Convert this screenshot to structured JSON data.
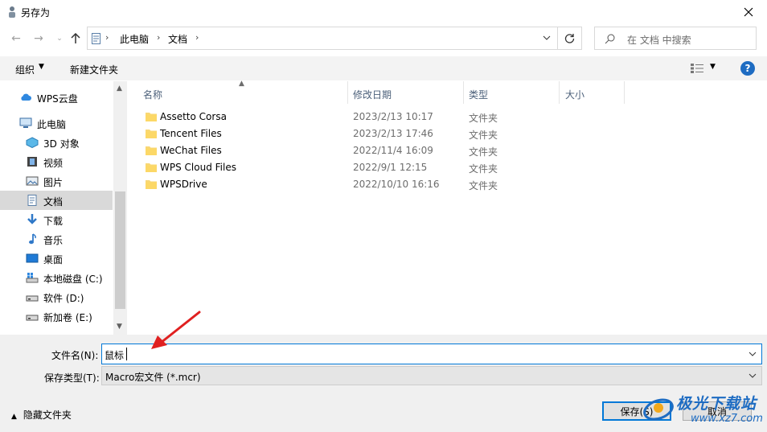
{
  "window": {
    "title": "另存为"
  },
  "address": {
    "crumbs": [
      "此电脑",
      "文档"
    ],
    "search_placeholder": "在 文档 中搜索"
  },
  "toolbar": {
    "organize_label": "组织",
    "new_folder_label": "新建文件夹",
    "help_label": "?"
  },
  "nav": {
    "items": [
      {
        "label": "WPS云盘",
        "icon": "cloud-icon"
      },
      {
        "label": "此电脑",
        "icon": "computer-icon"
      },
      {
        "label": "3D 对象",
        "icon": "3d-objects-icon"
      },
      {
        "label": "视频",
        "icon": "video-icon"
      },
      {
        "label": "图片",
        "icon": "pictures-icon"
      },
      {
        "label": "文档",
        "icon": "documents-icon",
        "selected": true
      },
      {
        "label": "下载",
        "icon": "download-icon"
      },
      {
        "label": "音乐",
        "icon": "music-icon"
      },
      {
        "label": "桌面",
        "icon": "desktop-icon"
      },
      {
        "label": "本地磁盘 (C:)",
        "icon": "system-drive-icon"
      },
      {
        "label": "软件 (D:)",
        "icon": "drive-icon"
      },
      {
        "label": "新加卷 (E:)",
        "icon": "drive-icon"
      }
    ]
  },
  "filelist": {
    "columns": [
      "名称",
      "修改日期",
      "类型",
      "大小"
    ],
    "rows": [
      {
        "name": "Assetto Corsa",
        "date": "2023/2/13 10:17",
        "type": "文件夹"
      },
      {
        "name": "Tencent Files",
        "date": "2023/2/13 17:46",
        "type": "文件夹"
      },
      {
        "name": "WeChat Files",
        "date": "2022/11/4 16:09",
        "type": "文件夹"
      },
      {
        "name": "WPS Cloud Files",
        "date": "2022/9/1 12:15",
        "type": "文件夹"
      },
      {
        "name": "WPSDrive",
        "date": "2022/10/10 16:16",
        "type": "文件夹"
      }
    ]
  },
  "form": {
    "filename_label": "文件名(N):",
    "filename_value": "鼠标",
    "filetype_label": "保存类型(T):",
    "filetype_value": "Macro宏文件 (*.mcr)"
  },
  "footer": {
    "hide_folders_label": "隐藏文件夹",
    "save_label": "保存(S)",
    "cancel_label": "取消"
  },
  "watermark": {
    "line1": "极光下载站",
    "line2": "www.xz7.com"
  },
  "colors": {
    "accent": "#0078d7",
    "folder": "#f8d775",
    "arrow": "#e02020",
    "selection": "#d9d9d9"
  }
}
